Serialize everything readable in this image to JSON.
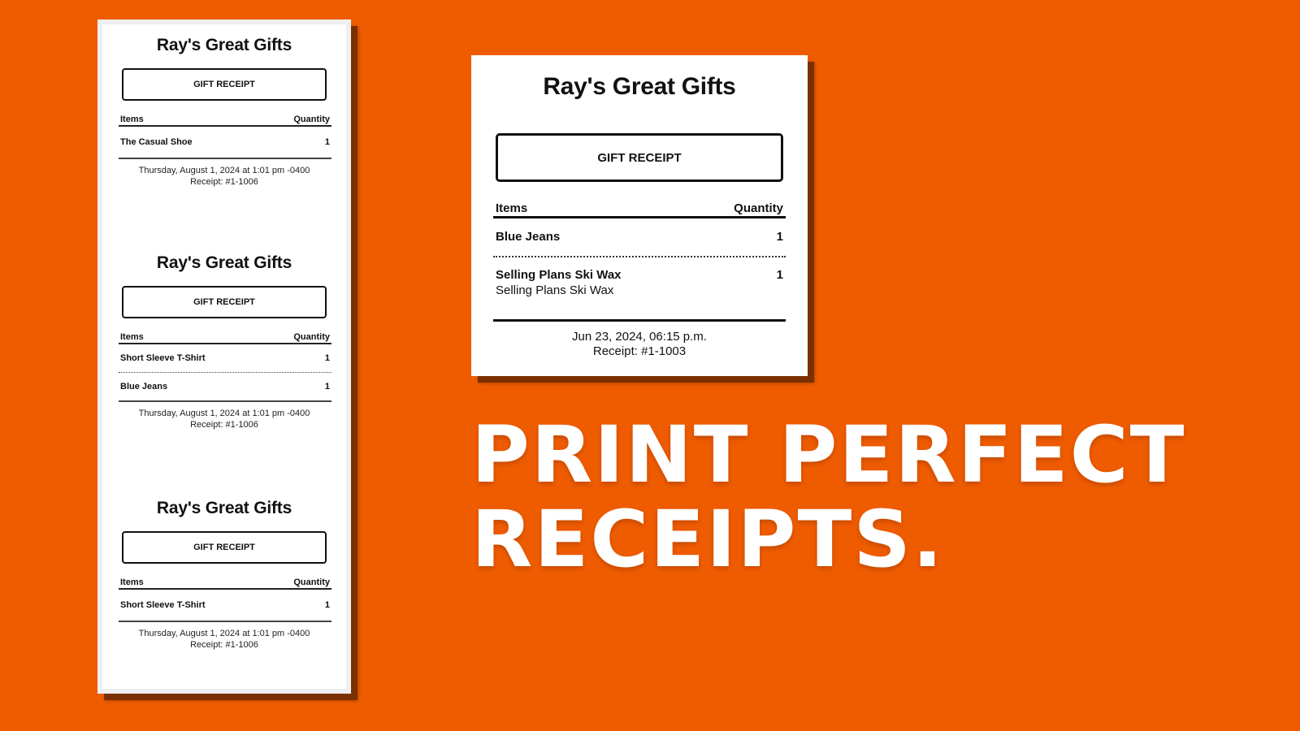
{
  "colors": {
    "background": "#ef5c00",
    "shadow": "#7a3000",
    "paper": "#ffffff",
    "text": "#111111"
  },
  "left_receipts": [
    {
      "store": "Ray's Great Gifts",
      "badge": "GIFT RECEIPT",
      "headers": {
        "items": "Items",
        "quantity": "Quantity"
      },
      "items": [
        {
          "name": "The Casual Shoe",
          "qty": "1"
        }
      ],
      "datetime": "Thursday, August 1, 2024 at 1:01 pm -0400",
      "receipt_no": "Receipt: #1-1006"
    },
    {
      "store": "Ray's Great Gifts",
      "badge": "GIFT RECEIPT",
      "headers": {
        "items": "Items",
        "quantity": "Quantity"
      },
      "items": [
        {
          "name": "Short Sleeve T-Shirt",
          "qty": "1"
        },
        {
          "name": "Blue Jeans",
          "qty": "1"
        }
      ],
      "datetime": "Thursday, August 1, 2024 at 1:01 pm -0400",
      "receipt_no": "Receipt: #1-1006"
    },
    {
      "store": "Ray's Great Gifts",
      "badge": "GIFT RECEIPT",
      "headers": {
        "items": "Items",
        "quantity": "Quantity"
      },
      "items": [
        {
          "name": "Short Sleeve T-Shirt",
          "qty": "1"
        }
      ],
      "datetime": "Thursday, August 1, 2024 at 1:01 pm -0400",
      "receipt_no": "Receipt: #1-1006"
    }
  ],
  "right_receipt": {
    "store": "Ray's Great Gifts",
    "badge": "GIFT RECEIPT",
    "headers": {
      "items": "Items",
      "quantity": "Quantity"
    },
    "items": [
      {
        "name": "Blue Jeans",
        "qty": "1"
      },
      {
        "name": "Selling Plans Ski Wax",
        "subtitle": "Selling Plans Ski Wax",
        "qty": "1"
      }
    ],
    "datetime": "Jun 23, 2024, 06:15 p.m.",
    "receipt_no": "Receipt: #1-1003"
  },
  "headline": {
    "line1": "PRINT PERFECT",
    "line2": "RECEIPTS."
  }
}
